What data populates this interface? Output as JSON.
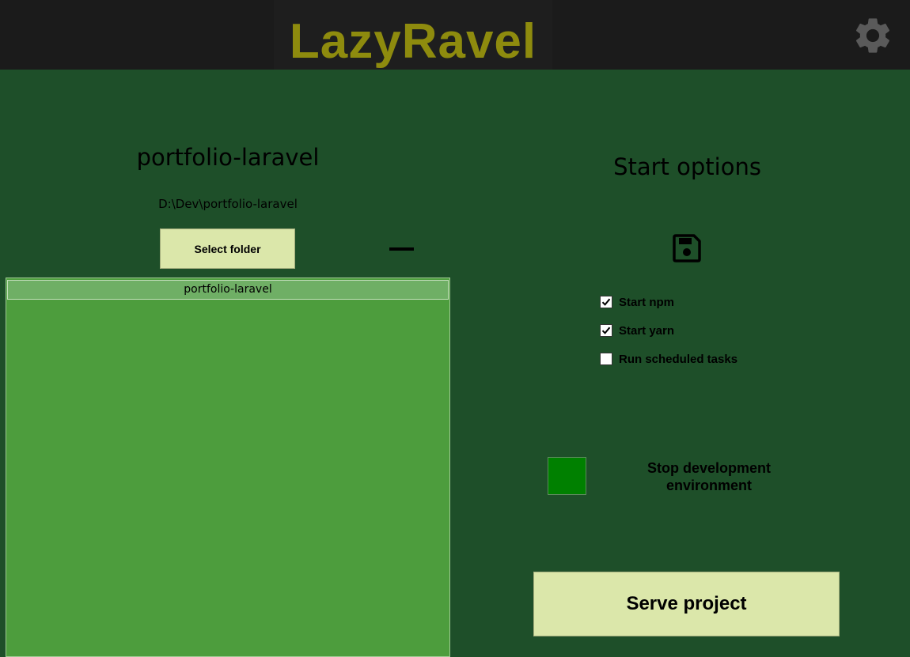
{
  "app": {
    "title": "LazyRavel"
  },
  "project": {
    "name": "portfolio-laravel",
    "path": "D:\\Dev\\portfolio-laravel",
    "select_folder_label": "Select folder"
  },
  "project_list": {
    "items": [
      {
        "label": "portfolio-laravel",
        "selected": true
      }
    ]
  },
  "start_options": {
    "title": "Start options",
    "options": [
      {
        "label": "Start npm",
        "checked": true
      },
      {
        "label": "Start yarn",
        "checked": true
      },
      {
        "label": "Run scheduled tasks",
        "checked": false
      }
    ]
  },
  "environment": {
    "status_color": "#008000",
    "stop_label": "Stop development environment"
  },
  "serve": {
    "label": "Serve project"
  },
  "icons": {
    "settings": "gear-icon",
    "save": "floppy-disk-icon",
    "remove": "minus-icon",
    "check": "checkmark-icon"
  },
  "colors": {
    "header_bg": "#1b1b1b",
    "title_color": "#8e8b0e",
    "main_bg": "#1e4f29",
    "button_bg": "#dbe7aa",
    "list_bg": "#4d9d3d",
    "list_selected_bg": "#6faf65"
  }
}
